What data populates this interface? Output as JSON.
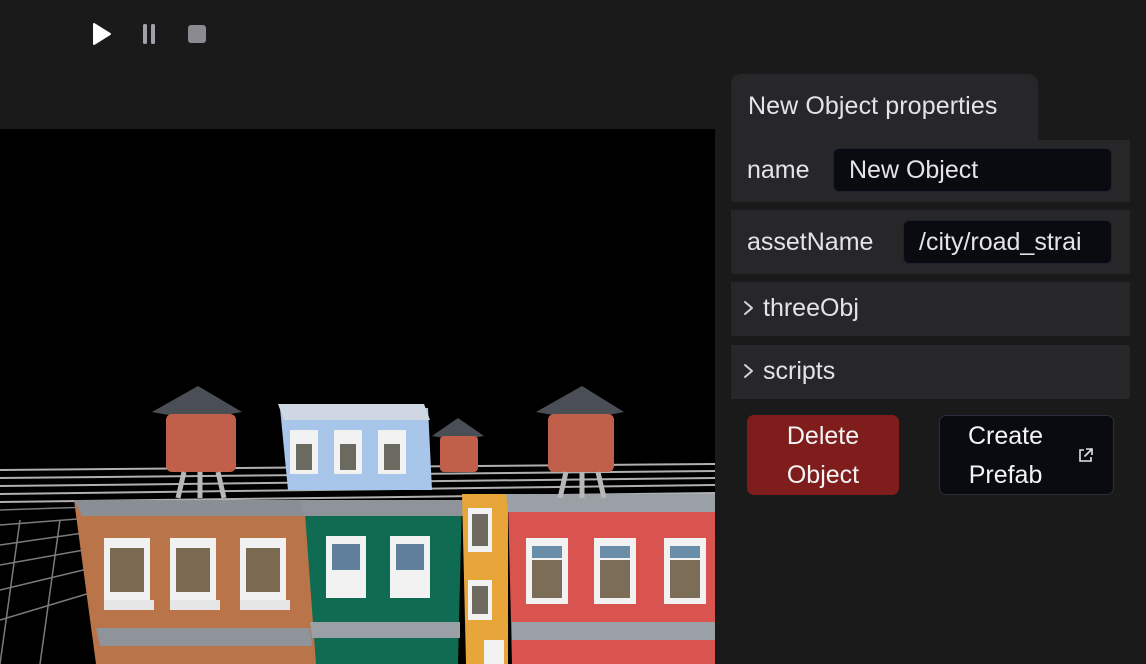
{
  "toolbar": {
    "play_icon": "play-icon",
    "pause_icon": "pause-icon",
    "stop_icon": "stop-icon"
  },
  "viewport": {
    "content": "3D city scene with row of colored buildings and rooftop water towers"
  },
  "properties": {
    "tab_title": "New Object properties",
    "name_label": "name",
    "name_value": "New Object",
    "asset_label": "assetName",
    "asset_value": "/city/road_strai",
    "sections": [
      {
        "label": "threeObj"
      },
      {
        "label": "scripts"
      }
    ],
    "delete_line1": "Delete",
    "delete_line2": "Object",
    "prefab_line1": "Create",
    "prefab_line2": "Prefab"
  },
  "colors": {
    "background": "#1a1a1b",
    "panel_card": "#27272a",
    "input_bg": "#090b11",
    "danger": "#7f1d1d"
  }
}
